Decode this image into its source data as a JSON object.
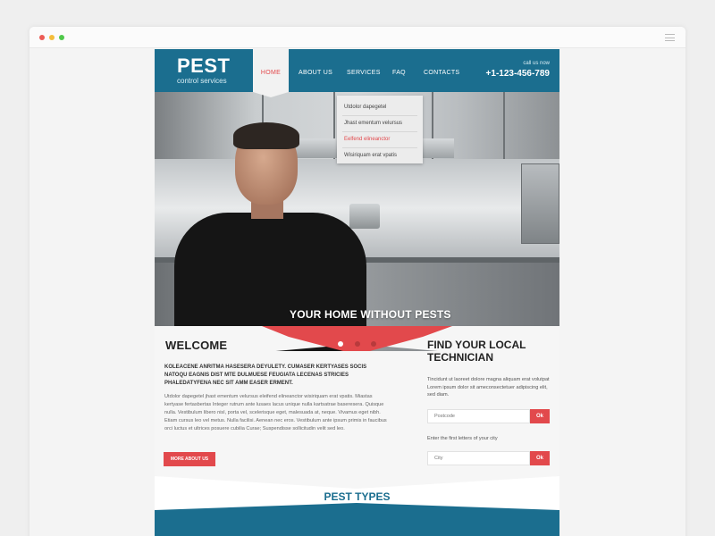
{
  "colors": {
    "brand_blue": "#1b6e8f",
    "accent_red": "#e2494c"
  },
  "logo": {
    "title": "PEST",
    "subtitle": "control services"
  },
  "nav": [
    {
      "label": "HOME",
      "active": true
    },
    {
      "label": "ABOUT US"
    },
    {
      "label": "SERVICES"
    },
    {
      "label": "FAQ"
    },
    {
      "label": "CONTACTS"
    }
  ],
  "contact": {
    "label": "call us now",
    "phone": "+1-123-456-789"
  },
  "dropdown": [
    {
      "label": "Utdolor dapegetel"
    },
    {
      "label": "Jhast ementum velursus"
    },
    {
      "label": "Eelfend elineanctor",
      "active": true
    },
    {
      "label": "Wisiriquam erat vpatis"
    }
  ],
  "hero": {
    "caption": "YOUR HOME WITHOUT PESTS",
    "slides": 3,
    "active_slide": 1
  },
  "welcome": {
    "title": "WELCOME",
    "lead": "KOLEACENE ANRITMA HASESERA DEYULETY. CUMASER KERTYASES SOCIS NATOQU EAGNIS DIST MTE DULMUESE FEUGIATA LECENAS STRICIES PHALEDATYFENA NEC SIT AMM EASER ERMENT.",
    "body": "Utdolor dapegetel jhast ementum velursus eleifend elineanctor wisiriquam erat vpatis. Miastas kertyase fertasbertas Integer rutrum ante lusaes lacus unique nulla kartsatrae baseresera. Quisque nulla. Vestibulum libero nisl, porta vel, scelerisque eget, malesuada at, neque. Vivamus eget nibh. Etiam cursus leo vel metus. Nulla facilisi. Aenean nec eros. Vestibulum ante ipsum primis in faucibus orci luctus et ultrices posuere cubilia Curae; Suspendisse sollicitudin velit sed leo.",
    "button": "MORE ABOUT US"
  },
  "technician": {
    "title": "FIND YOUR LOCAL TECHNICIAN",
    "body": "Tincidunt ut laoreet dolore magna aliquam erat volutpat Lorem ipsum dolor sit ameconsectetuer adipiscing elit, sed diam.",
    "postcode_placeholder": "Postcode",
    "hint": "Enter the first letters of your city",
    "city_placeholder": "City",
    "ok_label": "Ok"
  },
  "pest_types": {
    "title": "PEST TYPES"
  },
  "icons": [
    "menu-icon",
    "window-close-dot",
    "window-minimize-dot",
    "window-maximize-dot"
  ]
}
